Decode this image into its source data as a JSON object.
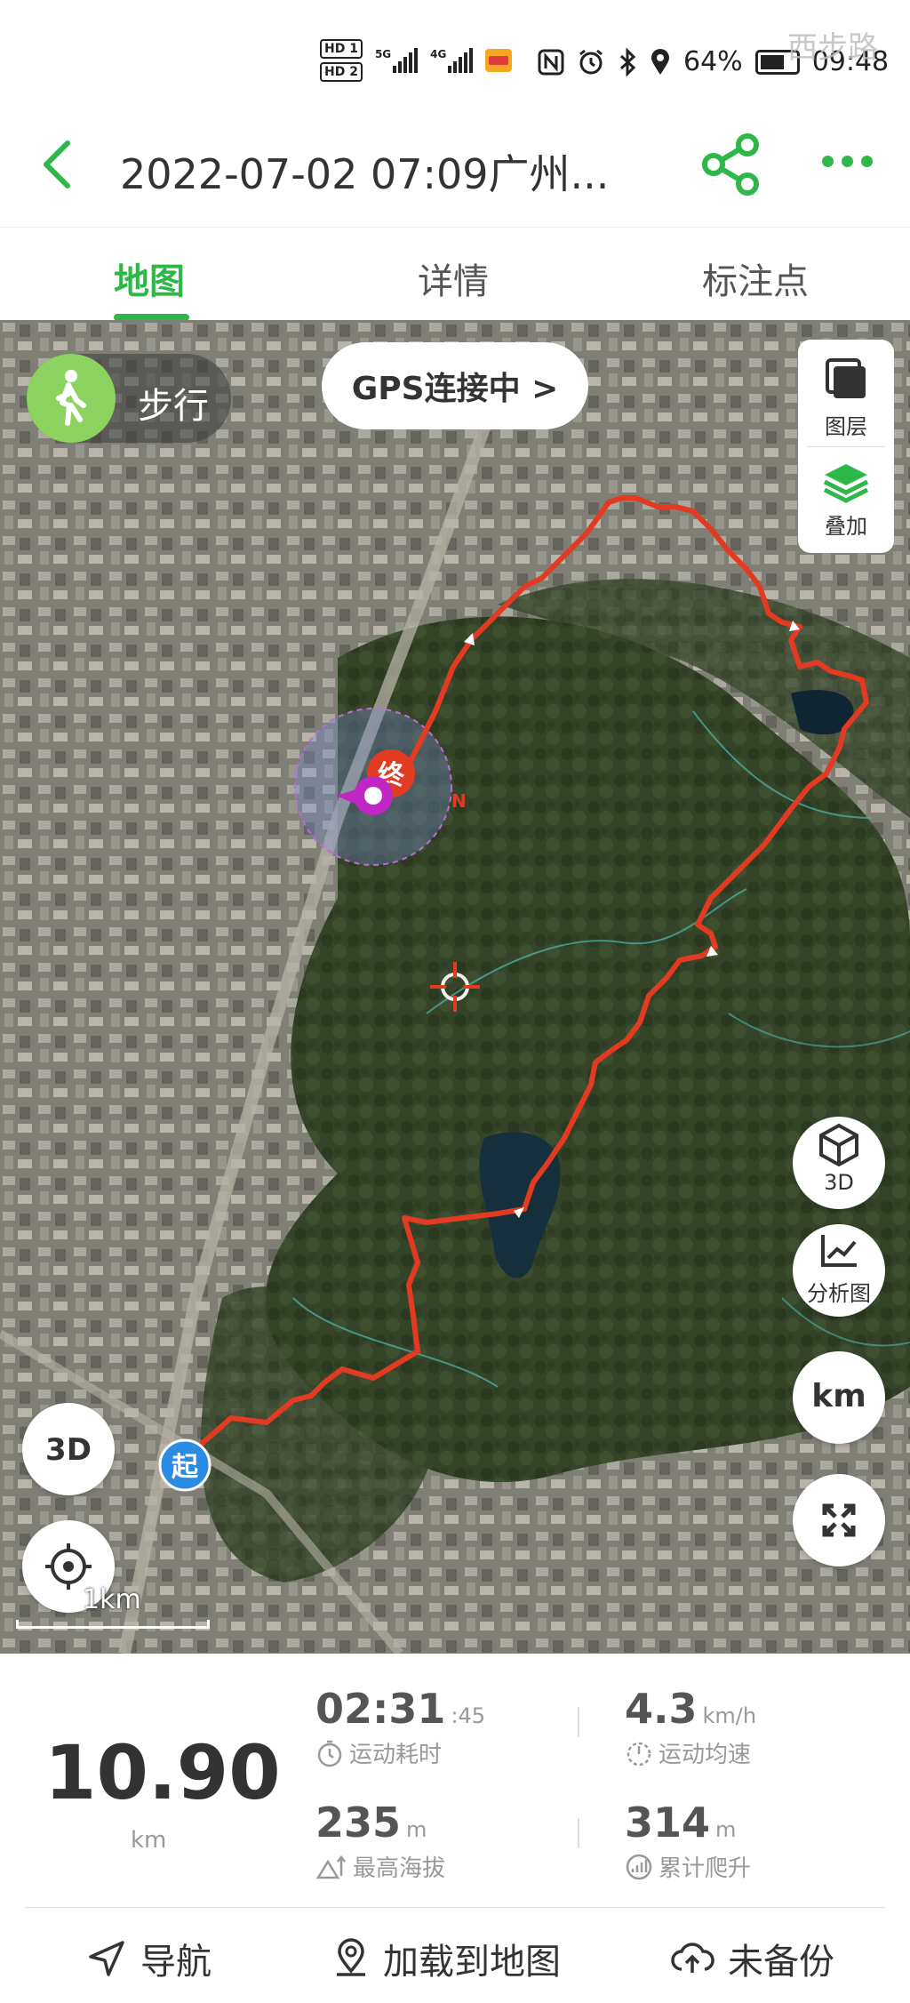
{
  "status_bar": {
    "hd1": "HD 1",
    "hd2": "HD 2",
    "sig1_tag": "5G",
    "sig2_tag": "4G",
    "battery_percent": "64%",
    "time": "09:48",
    "watermark": "西步路"
  },
  "header": {
    "title": "2022-07-02 07:09广州...",
    "accent_color": "#2fb84a"
  },
  "tabs": [
    {
      "label": "地图",
      "active": true
    },
    {
      "label": "详情",
      "active": false
    },
    {
      "label": "标注点",
      "active": false
    }
  ],
  "map": {
    "mode_label": "步行",
    "gps_status": "GPS连接中 >",
    "layer_label": "图层",
    "overlay_label": "叠加",
    "btn_3d_label": "3D",
    "btn_analysis_label": "分析图",
    "btn_km_label": "km",
    "scale_label": "1km",
    "start_marker": "起",
    "end_marker": "终",
    "track_color": "#e33a22"
  },
  "stats": {
    "distance": "10.90",
    "distance_unit": "km",
    "duration_main": "02:31",
    "duration_sec": ":45",
    "duration_label": "运动耗时",
    "speed_value": "4.3",
    "speed_unit": "km/h",
    "speed_label": "运动均速",
    "max_alt_value": "235",
    "max_alt_unit": "m",
    "max_alt_label": "最高海拔",
    "climb_value": "314",
    "climb_unit": "m",
    "climb_label": "累计爬升"
  },
  "actions": {
    "navigate": "导航",
    "load_to_map": "加载到地图",
    "backup": "未备份"
  }
}
